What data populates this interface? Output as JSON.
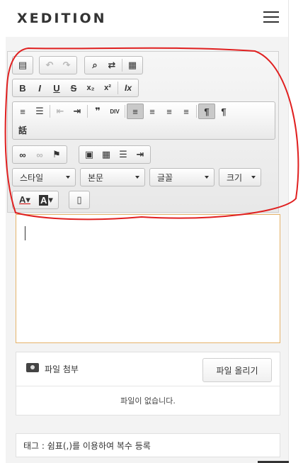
{
  "header": {
    "logo": "XEDITION",
    "menu_icon": "hamburger-icon"
  },
  "toolbar": {
    "row1": [
      {
        "name": "source-icon",
        "glyph": "▤"
      },
      {
        "name": "undo-icon",
        "glyph": "↶",
        "disabled": true
      },
      {
        "name": "redo-icon",
        "glyph": "↷",
        "disabled": true
      },
      {
        "name": "find-icon",
        "glyph": "⌕"
      },
      {
        "name": "replace-icon",
        "glyph": "⇄"
      },
      {
        "name": "paste-icon",
        "glyph": "▦"
      }
    ],
    "row2": [
      {
        "name": "bold-icon",
        "glyph": "B"
      },
      {
        "name": "italic-icon",
        "glyph": "I"
      },
      {
        "name": "underline-icon",
        "glyph": "U"
      },
      {
        "name": "strike-icon",
        "glyph": "S"
      },
      {
        "name": "subscript-icon",
        "glyph": "x₂"
      },
      {
        "name": "superscript-icon",
        "glyph": "x²"
      },
      {
        "name": "remove-format-icon",
        "glyph": "Ix"
      }
    ],
    "row3": [
      {
        "name": "numbered-list-icon",
        "glyph": "≡"
      },
      {
        "name": "bulleted-list-icon",
        "glyph": "☰"
      },
      {
        "name": "outdent-icon",
        "glyph": "⇤",
        "disabled": true
      },
      {
        "name": "indent-icon",
        "glyph": "⇥"
      },
      {
        "name": "blockquote-icon",
        "glyph": "❞"
      },
      {
        "name": "div-icon",
        "glyph": "DIV"
      },
      {
        "name": "align-left-icon",
        "glyph": "≡",
        "active": true
      },
      {
        "name": "align-center-icon",
        "glyph": "≡"
      },
      {
        "name": "align-right-icon",
        "glyph": "≡"
      },
      {
        "name": "justify-icon",
        "glyph": "≡"
      },
      {
        "name": "ltr-icon",
        "glyph": "¶",
        "active": true
      },
      {
        "name": "rtl-icon",
        "glyph": "¶"
      },
      {
        "name": "language-icon",
        "glyph": "話"
      }
    ],
    "row4": [
      {
        "name": "link-icon",
        "glyph": "∞"
      },
      {
        "name": "unlink-icon",
        "glyph": "∞",
        "disabled": true
      },
      {
        "name": "anchor-icon",
        "glyph": "⚑"
      },
      {
        "name": "image-icon",
        "glyph": "▣"
      },
      {
        "name": "table-icon",
        "glyph": "▦"
      },
      {
        "name": "horizontal-line-icon",
        "glyph": "☰"
      },
      {
        "name": "page-break-icon",
        "glyph": "⇥"
      }
    ],
    "combos": {
      "style": "스타일",
      "format": "본문",
      "font": "글꼴",
      "size": "크기"
    },
    "row6": [
      {
        "name": "text-color-icon",
        "glyph": "A"
      },
      {
        "name": "bg-color-icon",
        "glyph": "A"
      },
      {
        "name": "maximize-icon",
        "glyph": "▯"
      }
    ]
  },
  "attachment": {
    "title": "파일 첨부",
    "upload_button": "파일 올리기",
    "empty_text": "파일이 없습니다."
  },
  "tags": {
    "placeholder": "태그 : 쉼표(,)를 이용하여 복수 등록"
  }
}
